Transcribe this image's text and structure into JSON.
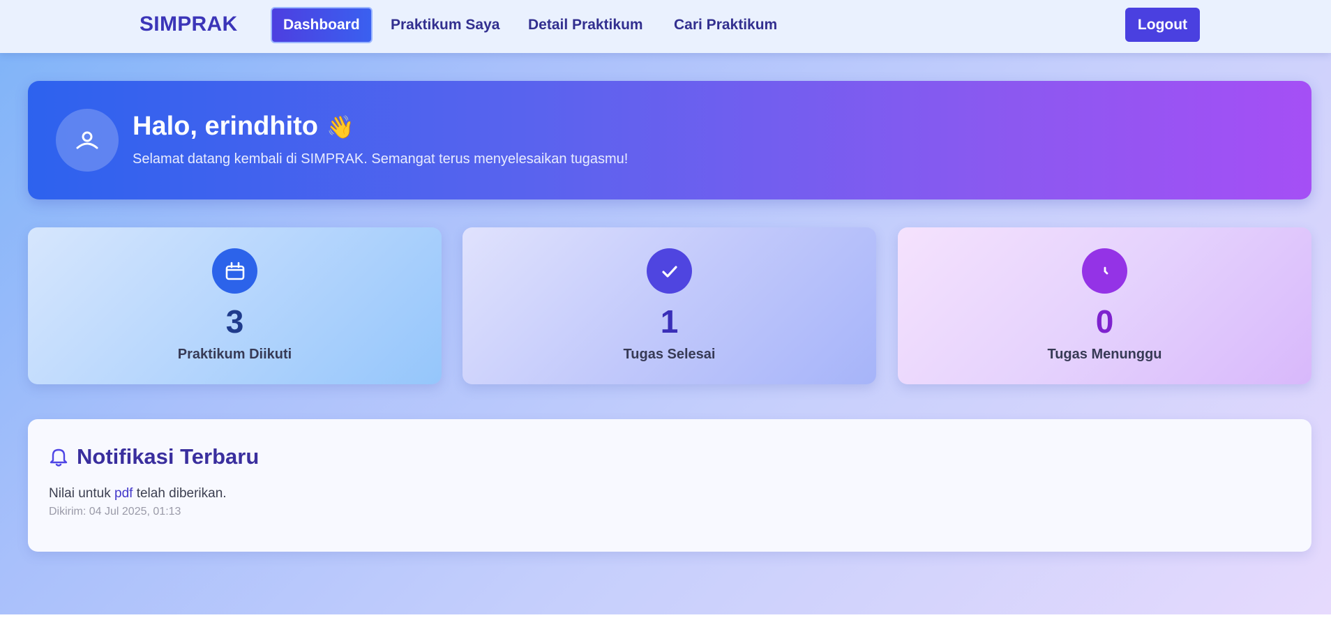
{
  "nav": {
    "brand": "SIMPRAK",
    "links": [
      {
        "label": "Dashboard",
        "active": true
      },
      {
        "label": "Praktikum Saya",
        "active": false
      },
      {
        "label": "Detail Praktikum",
        "active": false
      },
      {
        "label": "Cari Praktikum",
        "active": false
      }
    ],
    "logout_label": "Logout"
  },
  "hero": {
    "greeting": "Halo, erindhito",
    "wave_emoji": "👋",
    "subtitle": "Selamat datang kembali di SIMPRAK. Semangat terus menyelesaikan tugasmu!",
    "avatar_icon": "user-icon"
  },
  "stats": [
    {
      "value": "3",
      "label": "Praktikum Diikuti",
      "icon": "calendar-icon",
      "color": "#2c63ea"
    },
    {
      "value": "1",
      "label": "Tugas Selesai",
      "icon": "check-icon",
      "color": "#4f45e0"
    },
    {
      "value": "0",
      "label": "Tugas Menunggu",
      "icon": "clock-icon",
      "color": "#9433e6"
    }
  ],
  "notifications": {
    "title": "Notifikasi Terbaru",
    "icon": "bell-icon",
    "items": [
      {
        "prefix": "Nilai untuk ",
        "link": "pdf",
        "suffix": " telah diberikan.",
        "time": "Dikirim: 04 Jul 2025, 01:13"
      }
    ]
  }
}
